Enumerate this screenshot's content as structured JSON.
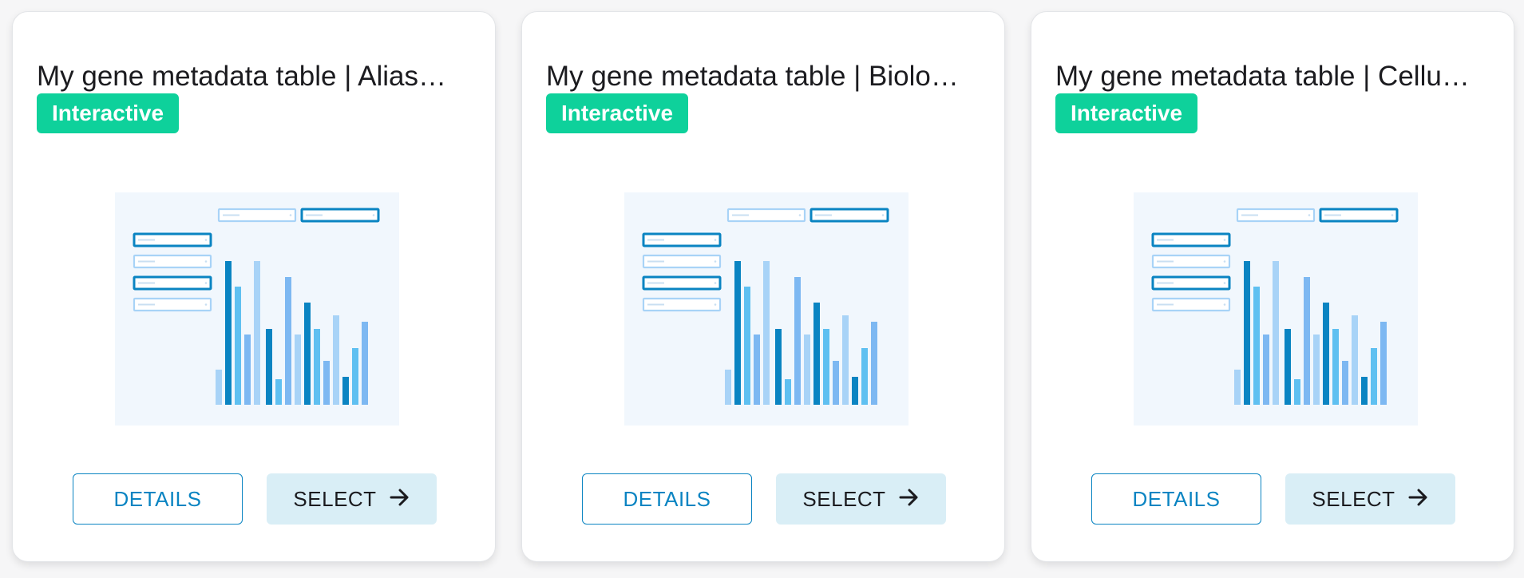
{
  "cards": [
    {
      "title": "My gene metadata table | Alias…",
      "badge": "Interactive",
      "details_label": "DETAILS",
      "select_label": "SELECT"
    },
    {
      "title": "My gene metadata table | Biolo…",
      "badge": "Interactive",
      "details_label": "DETAILS",
      "select_label": "SELECT"
    },
    {
      "title": "My gene metadata table | Cellu…",
      "badge": "Interactive",
      "details_label": "DETAILS",
      "select_label": "SELECT"
    }
  ],
  "icons": {
    "select_arrow": "arrow-right-icon",
    "preview": "interactive-chart-preview-icon"
  },
  "colors": {
    "badge_bg": "#0ed19b",
    "primary_blue": "#0a84c2",
    "select_bg": "#d9eef6",
    "preview_bg": "#f1f7fd"
  }
}
